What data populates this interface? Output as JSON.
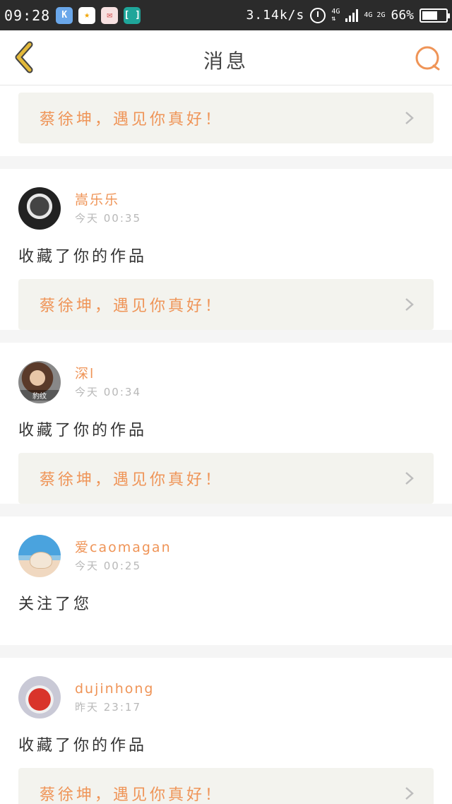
{
  "status_bar": {
    "time": "09:28",
    "apps": [
      "K",
      "★",
      "✉",
      "[ ]"
    ],
    "net_speed": "3.14k/s",
    "net_top": "4G",
    "net_bottom": "4G 2G",
    "battery": "66%",
    "battery_level": 0.66
  },
  "header": {
    "title": "消息"
  },
  "messages": [
    {
      "link_text": "蔡徐坤，遇见你真好！"
    },
    {
      "username": "嵩乐乐",
      "time": "今天 00:35",
      "action": "收藏了你的作品",
      "link_text": "蔡徐坤，遇见你真好！"
    },
    {
      "username": "深l",
      "time": "今天 00:34",
      "avatar_caption": "豹纹",
      "action": "收藏了你的作品",
      "link_text": "蔡徐坤，遇见你真好！"
    },
    {
      "username": "爱caomagan",
      "time": "今天 00:25",
      "action": "关注了您"
    },
    {
      "username": "dujinhong",
      "time": "昨天 23:17",
      "action": "收藏了你的作品",
      "link_text": "蔡徐坤，遇见你真好！"
    }
  ],
  "colors": {
    "accent": "#ef9457",
    "back_icon": "#e3b93a",
    "link_bg": "#f3f3ee"
  }
}
